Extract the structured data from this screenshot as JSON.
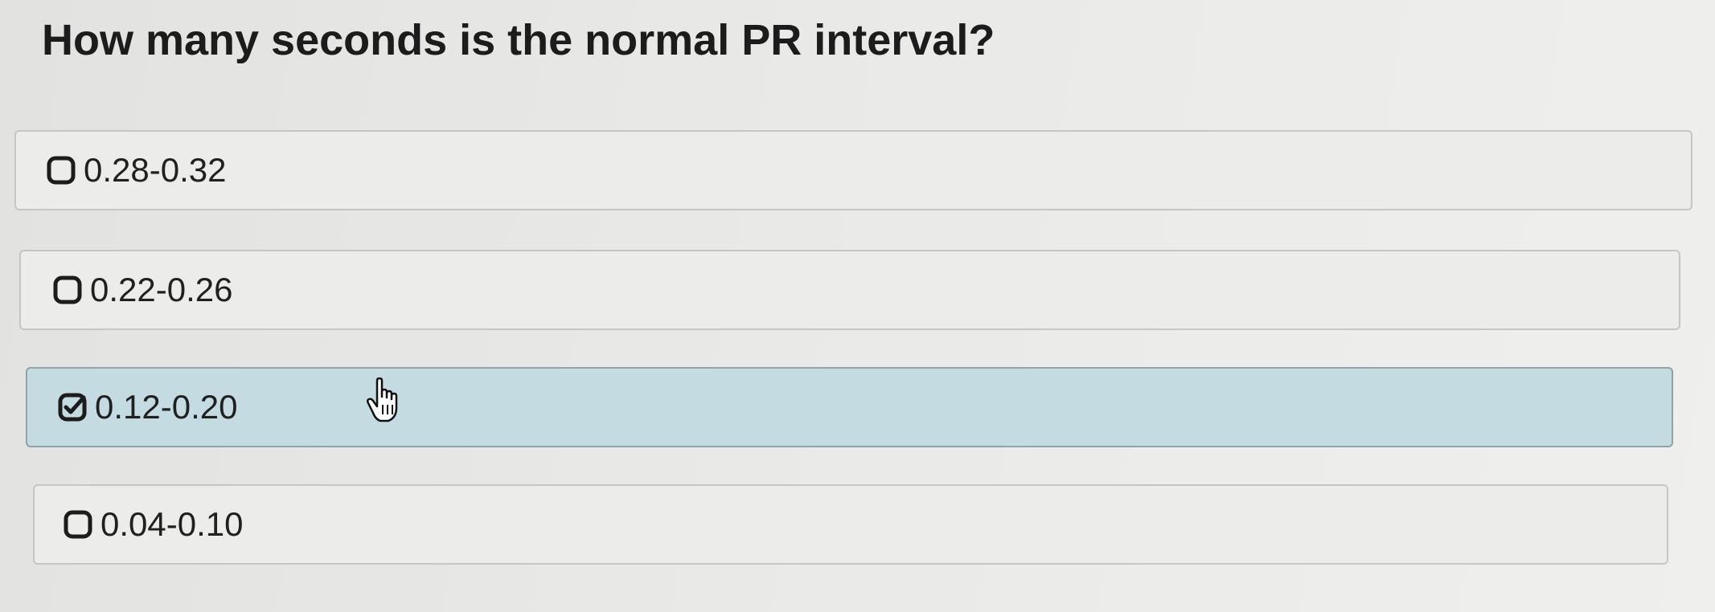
{
  "question": "How many seconds is the normal PR interval?",
  "options": [
    {
      "label": "0.28-0.32",
      "checked": false,
      "icon": "empty-checkbox-icon"
    },
    {
      "label": "0.22-0.26",
      "checked": false,
      "icon": "empty-checkbox-icon"
    },
    {
      "label": "0.12-0.20",
      "checked": true,
      "icon": "checked-checkbox-icon"
    },
    {
      "label": "0.04-0.10",
      "checked": false,
      "icon": "empty-checkbox-icon"
    }
  ],
  "colors": {
    "selected_background": "#c5dbe2",
    "option_background": "#ececea",
    "border": "#c6c6c4"
  }
}
